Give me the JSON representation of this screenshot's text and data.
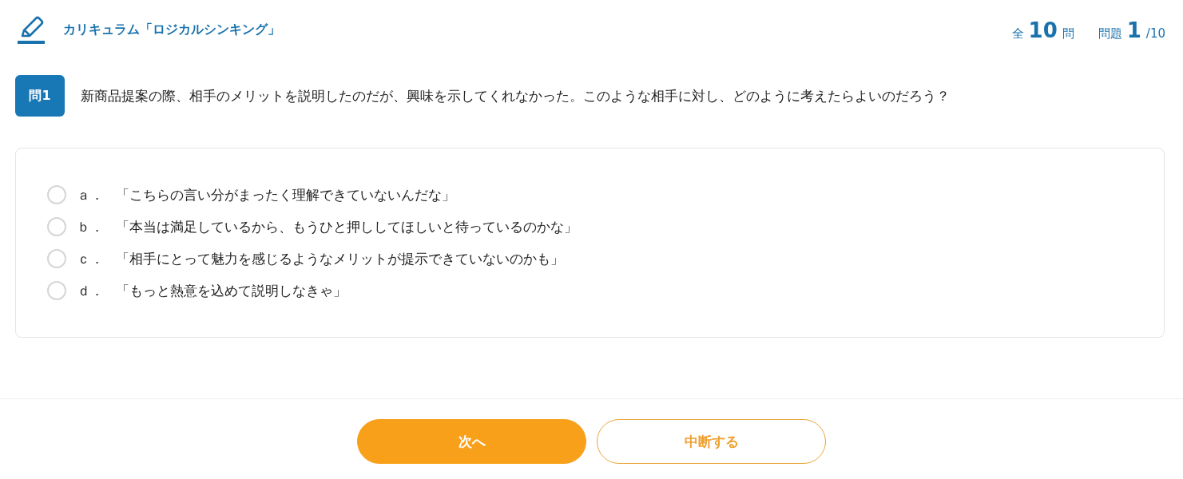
{
  "header": {
    "title": "カリキュラム「ロジカルシンキング」",
    "total": {
      "prefix": "全",
      "count": "10",
      "suffix": "問"
    },
    "progress": {
      "label": "問題",
      "current": "1",
      "total": "/10"
    }
  },
  "question": {
    "badge": "問1",
    "text": "新商品提案の際、相手のメリットを説明したのだが、興味を示してくれなかった。このような相手に対し、どのように考えたらよいのだろう？"
  },
  "options": [
    {
      "letter": "ａ．",
      "text": "「こちらの言い分がまったく理解できていないんだな」",
      "selected": false
    },
    {
      "letter": "ｂ．",
      "text": "「本当は満足しているから、もうひと押ししてほしいと待っているのかな」",
      "selected": false
    },
    {
      "letter": "ｃ．",
      "text": "「相手にとって魅力を感じるようなメリットが提示できていないのかも」",
      "selected": false
    },
    {
      "letter": "ｄ．",
      "text": "「もっと熱意を込めて説明しなきゃ」",
      "selected": false
    }
  ],
  "buttons": [
    {
      "label": "次へ",
      "kind": "primary"
    },
    {
      "label": "中断する",
      "kind": "secondary"
    }
  ]
}
